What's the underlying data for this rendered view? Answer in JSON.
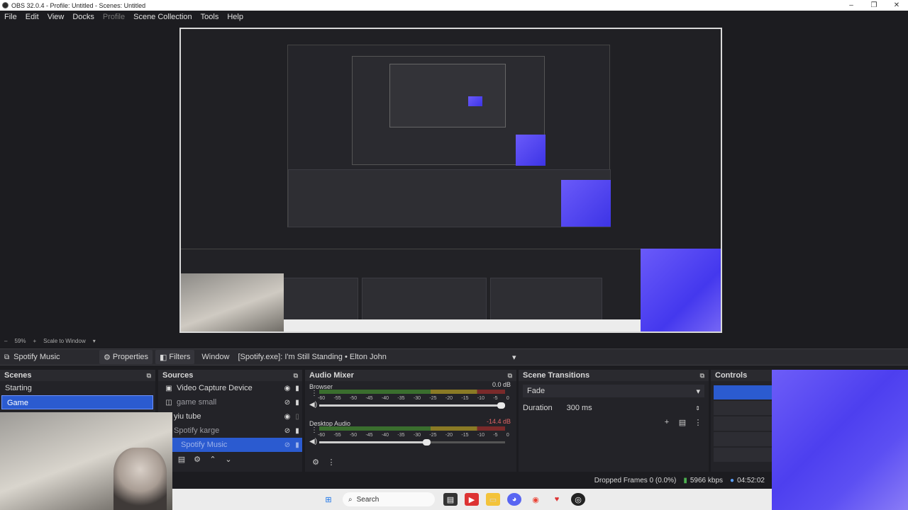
{
  "window": {
    "title": "OBS 32.0.4 - Profile: Untitled - Scenes: Untitled",
    "min": "–",
    "max": "❐",
    "close": "✕"
  },
  "menu": [
    "File",
    "Edit",
    "View",
    "Docks",
    "Profile",
    "Scene Collection",
    "Tools",
    "Help"
  ],
  "zoom": {
    "minus": "–",
    "percent": "59%",
    "plus": "+",
    "scale": "Scale to Window",
    "arrow": "▾"
  },
  "source_bar": {
    "source_name": "Spotify Music",
    "properties_label": "Properties",
    "filters_label": "Filters",
    "window_label": "Window",
    "window_value": "[Spotify.exe]: I'm Still Standing • Elton John"
  },
  "scenes": {
    "title": "Scenes",
    "items": [
      "Starting",
      "Game"
    ],
    "selected": 1
  },
  "sources": {
    "title": "Sources",
    "items": [
      {
        "name": "Video Capture Device",
        "visible": true,
        "dim": false
      },
      {
        "name": "game small",
        "visible": false,
        "dim": true
      },
      {
        "name": "yiu tube",
        "visible": true,
        "dim": false
      },
      {
        "name": "Spotify karge",
        "visible": false,
        "dim": true
      },
      {
        "name": "Spotify Music",
        "visible": false,
        "dim": true
      }
    ]
  },
  "audio_mixer": {
    "title": "Audio Mixer",
    "scale": [
      "-60",
      "-55",
      "-50",
      "-45",
      "-40",
      "-35",
      "-30",
      "-25",
      "-20",
      "-15",
      "-10",
      "-5",
      "0"
    ],
    "channels": [
      {
        "name": "Browser",
        "db": "0.0 dB",
        "volume": 1.0
      },
      {
        "name": "Desktop Audio",
        "db": "-14.4 dB",
        "volume": 0.6
      }
    ]
  },
  "scene_transitions": {
    "title": "Scene Transitions",
    "transition": "Fade",
    "duration_label": "Duration",
    "duration": "300 ms"
  },
  "controls": {
    "title": "Controls"
  },
  "status": {
    "dropped_frames": "Dropped Frames 0 (0.0%)",
    "bitrate": "5966 kbps",
    "time": "04:52:02"
  },
  "taskbar": {
    "search": "Search"
  },
  "icons": {
    "scene_dock": "⧉",
    "gear": "⚙",
    "trash": "🗑",
    "up": "⌃",
    "down": "⌄",
    "eye": "👁",
    "lock": "🔒",
    "menu_dots": "⋮",
    "plus": "+",
    "speaker": "🔊",
    "chevron": "▾"
  }
}
